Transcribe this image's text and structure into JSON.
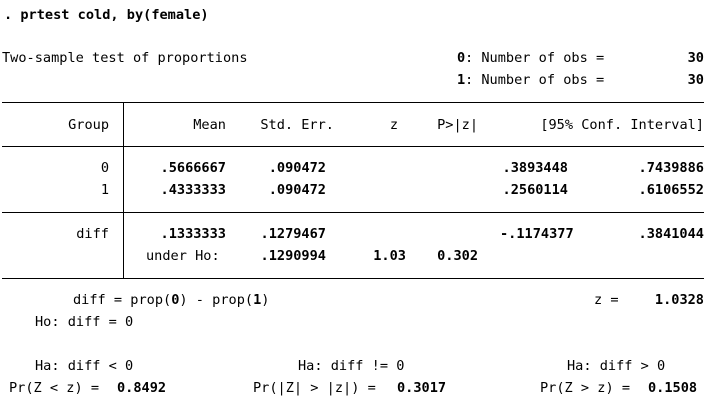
{
  "command": ". prtest cold, by(female)",
  "test_title": "Two-sample test of proportions",
  "obs": [
    {
      "group": "0",
      "label": ": Number of obs =",
      "value": "30"
    },
    {
      "group": "1",
      "label": ": Number of obs =",
      "value": "30"
    }
  ],
  "table": {
    "headers": {
      "group": "Group",
      "mean": "Mean",
      "se": "Std. Err.",
      "z": "z",
      "p": "P>|z|",
      "ci": "[95% Conf. Interval]"
    },
    "rows": [
      {
        "group": "0",
        "mean": ".5666667",
        "se": ".090472",
        "ci_low": ".3893448",
        "ci_high": ".7439886"
      },
      {
        "group": "1",
        "mean": ".4333333",
        "se": ".090472",
        "ci_low": ".2560114",
        "ci_high": ".6106552"
      }
    ],
    "diff": {
      "label": "diff",
      "mean": ".1333333",
      "se": ".1279467",
      "ci_low": "-.1174377",
      "ci_high": ".3841044",
      "under_label": "under Ho:",
      "under_se": ".1290994",
      "z": "1.03",
      "p": "0.302"
    }
  },
  "stats": {
    "diff_def_pre": "diff = prop(",
    "diff_def_g0": "0",
    "diff_def_mid": ") - prop(",
    "diff_def_g1": "1",
    "diff_def_post": ")",
    "z_label": "z =",
    "z_value": "1.0328",
    "ho": "Ho: diff = 0"
  },
  "alternatives": [
    {
      "ha": "Ha: diff < 0",
      "pr_label": "Pr(Z < z) =",
      "pr_value": "0.8492"
    },
    {
      "ha": "Ha: diff != 0",
      "pr_label": "Pr(|Z| > |z|) =",
      "pr_value": "0.3017"
    },
    {
      "ha": "Ha: diff > 0",
      "pr_label": "Pr(Z > z) =",
      "pr_value": "0.1508"
    }
  ]
}
